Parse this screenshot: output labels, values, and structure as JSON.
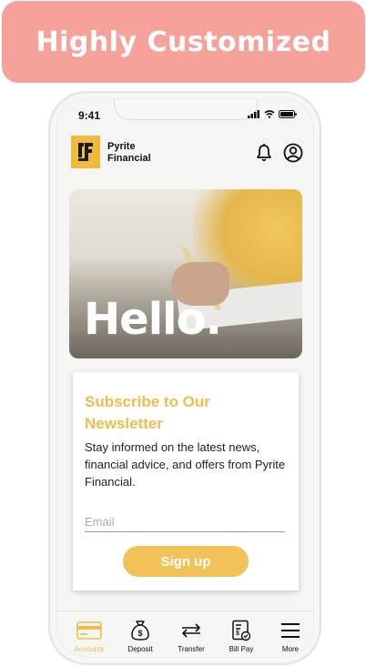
{
  "banner": {
    "title": "Highly Customized"
  },
  "status": {
    "time": "9:41"
  },
  "brand": {
    "line1": "Pyrite",
    "line2": "Financial"
  },
  "hero": {
    "greeting": "Hello."
  },
  "newsletter": {
    "title": "Subscribe to Our Newsletter",
    "description": "Stay informed on the latest news, financial advice, and offers from Pyrite Financial.",
    "email_placeholder": "Email",
    "signup_label": "Sign up"
  },
  "tabs": [
    {
      "label": "Accounts",
      "icon": "card-icon",
      "active": true
    },
    {
      "label": "Deposit",
      "icon": "money-bag-icon",
      "active": false
    },
    {
      "label": "Transfer",
      "icon": "transfer-arrows-icon",
      "active": false
    },
    {
      "label": "Bill Pay",
      "icon": "bill-icon",
      "active": false
    },
    {
      "label": "More",
      "icon": "menu-icon",
      "active": false
    }
  ],
  "colors": {
    "accent": "#f0c257",
    "banner": "#f4a29a",
    "logo": "#f0bb3c"
  }
}
